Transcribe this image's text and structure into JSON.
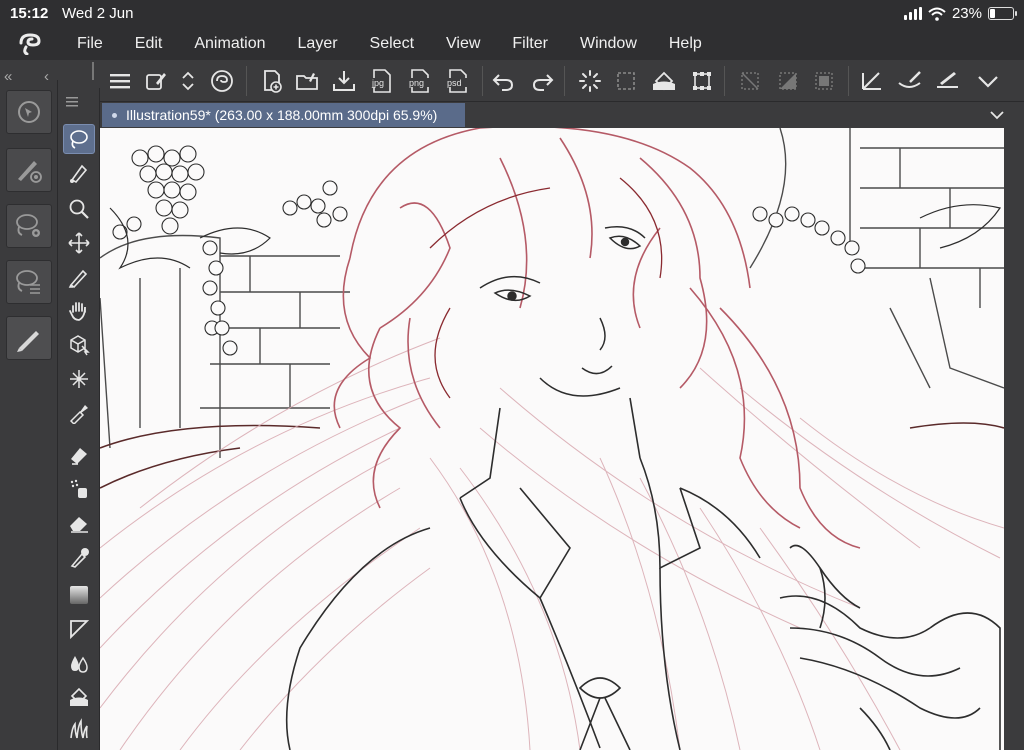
{
  "status": {
    "time": "15:12",
    "date": "Wed 2 Jun",
    "battery_text": "23%",
    "battery_level": 0.23
  },
  "menu": [
    "File",
    "Edit",
    "Animation",
    "Layer",
    "Select",
    "View",
    "Filter",
    "Window",
    "Help"
  ],
  "toolbar": {
    "icons": [
      "menu-icon",
      "new-page-icon",
      "up-down-icon",
      "clip-logo-icon",
      "new-file-icon",
      "open-folder-icon",
      "save-icon",
      "export-jpg-icon",
      "export-png-icon",
      "export-psd-icon",
      "undo-icon",
      "redo-icon",
      "loading-icon",
      "select-rect-icon",
      "fill-icon",
      "transform-icon",
      "hide-selection-icon",
      "clear-icon",
      "fill-selection-icon",
      "ruler-icon",
      "brush-ruler-icon",
      "edit-ruler-icon",
      "more-chevron-icon"
    ],
    "export_labels": {
      "jpg": "jpg",
      "png": "png",
      "psd": "psd"
    }
  },
  "document": {
    "tab_label": "Illustration59* (263.00 x 188.00mm 300dpi 65.9%)"
  },
  "tools": [
    "lasso",
    "pen-nib",
    "zoom",
    "move",
    "pen",
    "hand",
    "3d-object",
    "sparkle",
    "eyedropper",
    "ink-bottle",
    "spray",
    "eraser",
    "blend",
    "gradient",
    "shape",
    "watercolor-drops",
    "fill-bucket",
    "grass"
  ]
}
